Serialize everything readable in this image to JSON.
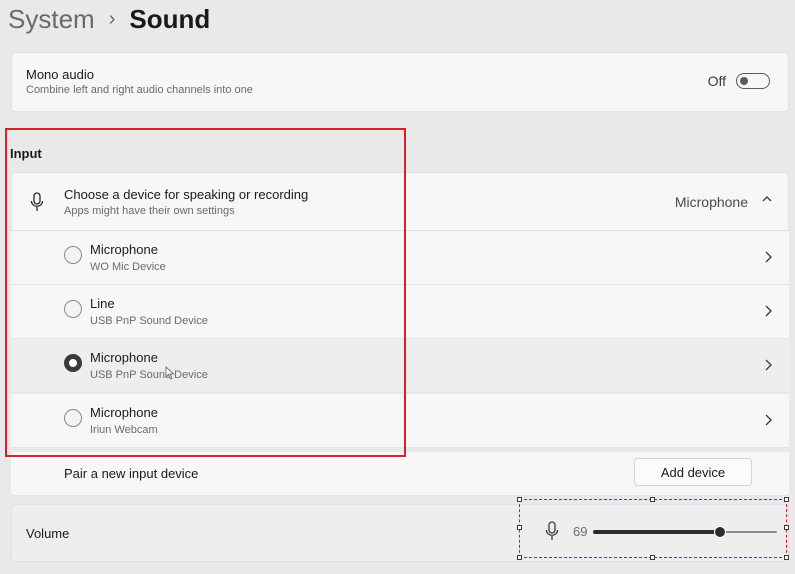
{
  "breadcrumb": {
    "parent": "System",
    "separator": "›",
    "current": "Sound"
  },
  "mono_audio": {
    "title": "Mono audio",
    "subtitle": "Combine left and right audio channels into one",
    "toggle_label": "Off",
    "enabled": false
  },
  "input": {
    "section_title": "Input",
    "choose": {
      "title": "Choose a device for speaking or recording",
      "subtitle": "Apps might have their own settings",
      "value": "Microphone"
    },
    "devices": [
      {
        "name": "Microphone",
        "description": "WO Mic Device",
        "selected": false
      },
      {
        "name": "Line",
        "description": "USB PnP Sound Device",
        "selected": false
      },
      {
        "name": "Microphone",
        "description": "USB PnP Sound Device",
        "selected": true
      },
      {
        "name": "Microphone",
        "description": "Iriun Webcam",
        "selected": false
      }
    ],
    "pair": {
      "label": "Pair a new input device",
      "button_label": "Add device"
    },
    "volume": {
      "label": "Volume",
      "value": "69",
      "level_percent": 69
    }
  },
  "icons": {
    "header_microphone": "microphone-icon",
    "volume_microphone": "microphone-icon",
    "expand": "chevron-up-icon",
    "row_arrow": "chevron-right-icon"
  },
  "colors": {
    "annotation_red": "#d4232b",
    "slider_fill": "#2c2c2c",
    "slider_track": "#8c8c8c",
    "panel_background": "#f7f7f7",
    "page_background": "#e9e9e9"
  }
}
